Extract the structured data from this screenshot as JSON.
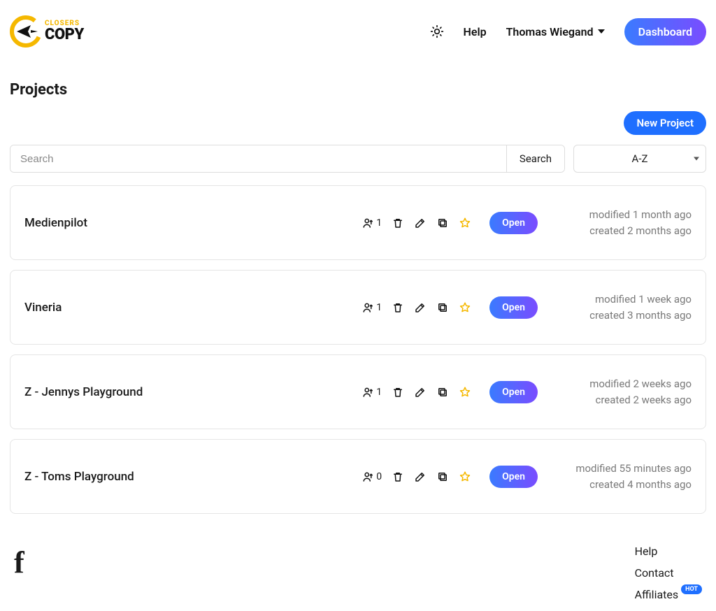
{
  "header": {
    "logo_top": "CLOSERS",
    "logo_bottom": "COPY",
    "help": "Help",
    "user": "Thomas Wiegand",
    "dashboard": "Dashboard"
  },
  "page": {
    "title": "Projects",
    "new_project": "New Project",
    "search_placeholder": "Search",
    "search_button": "Search",
    "sort": "A-Z"
  },
  "projects": [
    {
      "name": "Medienpilot",
      "members": "1",
      "open": "Open",
      "modified": "modified 1 month ago",
      "created": "created 2 months ago"
    },
    {
      "name": "Vineria",
      "members": "1",
      "open": "Open",
      "modified": "modified 1 week ago",
      "created": "created 3 months ago"
    },
    {
      "name": "Z - Jennys Playground",
      "members": "1",
      "open": "Open",
      "modified": "modified 2 weeks ago",
      "created": "created 2 weeks ago"
    },
    {
      "name": "Z - Toms Playground",
      "members": "0",
      "open": "Open",
      "modified": "modified 55 minutes ago",
      "created": "created 4 months ago"
    }
  ],
  "footer": {
    "help": "Help",
    "contact": "Contact",
    "affiliates": "Affiliates",
    "hot": "HOT"
  }
}
